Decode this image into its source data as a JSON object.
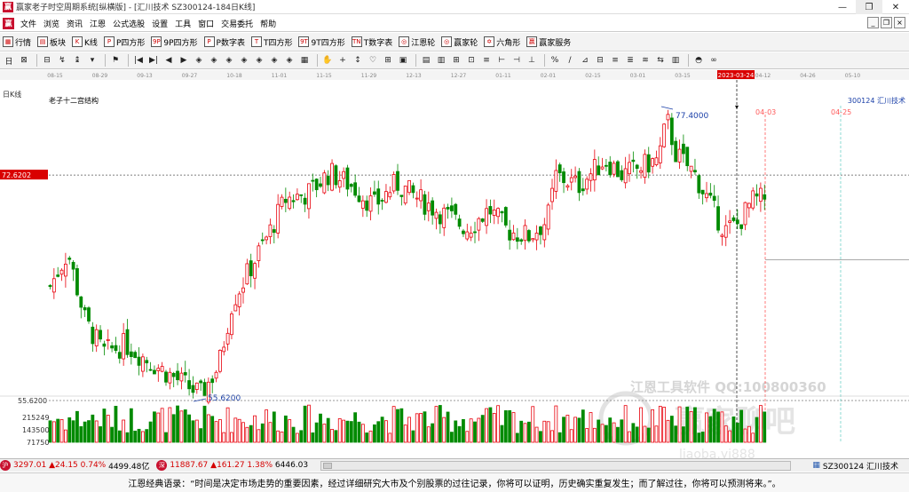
{
  "window": {
    "title": "赢家老子时空周期系统[纵横版] - [汇川技术  SZ300124-184日K线]",
    "app_icon_text": "赢",
    "buttons": [
      "—",
      "❐",
      "✕"
    ]
  },
  "menu": {
    "items": [
      "文件",
      "浏览",
      "资讯",
      "江恩",
      "公式选股",
      "设置",
      "工具",
      "窗口",
      "交易委托",
      "帮助"
    ],
    "mdi_buttons": [
      "_",
      "❐",
      "×"
    ]
  },
  "toolbar1": {
    "items": [
      {
        "glyph": "▦",
        "label": "行情"
      },
      {
        "glyph": "▤",
        "label": "板块"
      },
      {
        "glyph": "K",
        "label": "K线"
      },
      {
        "glyph": "P",
        "label": "P四方形"
      },
      {
        "glyph": "9P",
        "label": "9P四方形"
      },
      {
        "glyph": "P",
        "label": "P数字表"
      },
      {
        "glyph": "T",
        "label": "T四方形"
      },
      {
        "glyph": "9T",
        "label": "9T四方形"
      },
      {
        "glyph": "TN",
        "label": "T数字表"
      },
      {
        "glyph": "◎",
        "label": "江恩轮"
      },
      {
        "glyph": "◎",
        "label": "赢家轮"
      },
      {
        "glyph": "✡",
        "label": "六角形"
      },
      {
        "glyph": "赢",
        "label": "赢家服务"
      }
    ]
  },
  "toolbar2": {
    "icons": [
      "日",
      "⊠",
      "⊟",
      "↯",
      "↨",
      "▾",
      "⚑",
      "|◀",
      "▶|",
      "◀",
      "▶",
      "◈",
      "◈",
      "◈",
      "◈",
      "◈",
      "◈",
      "◈",
      "▦",
      "✋",
      "+",
      "↕",
      "♡",
      "⊞",
      "▣",
      "▤",
      "▥",
      "⊞",
      "⊡",
      "≡",
      "⊢",
      "⊣",
      "⊥",
      "%",
      "∕",
      "⊿",
      "⊟",
      "≡",
      "≣",
      "≋",
      "⇆",
      "▥",
      "◓",
      "∞"
    ]
  },
  "chart": {
    "period_label": "日K线",
    "indicator_name": "老子十二宫结构",
    "stock_label": "300124 汇川技术",
    "current_price_label": "72.6202",
    "high_label": "77.4000",
    "low_label": "55.6200",
    "low_axis_label": "55.6200",
    "cursor_date": "2023-03-24",
    "cycle_marks": [
      "04-03",
      "04-25"
    ],
    "volume_ticks": [
      "215249",
      "143500",
      "71750"
    ],
    "date_ticks": [
      "08-15",
      "08-29",
      "09-13",
      "09-27",
      "10-18",
      "11-01",
      "11-15",
      "11-29",
      "12-13",
      "12-27",
      "01-11",
      "02-01",
      "02-15",
      "03-01",
      "03-15",
      "04-12",
      "04-26",
      "05-10"
    ],
    "watermark_line1": "江恩工具软件  QQ:100800360",
    "watermark_line2": "赢家聊吧",
    "watermark_line3": "liaoba.yj888"
  },
  "status": {
    "sh_badge": "沪",
    "sh_index": "3297.01",
    "sh_change": "▲24.15 0.74%",
    "sh_amount": "4499.48亿",
    "sz_badge": "深",
    "sz_index": "11887.67",
    "sz_change": "▲161.27 1.38%",
    "sz_amount": "6446.03",
    "stock": "SZ300124 汇川技术"
  },
  "quote": {
    "text": "江恩经典语录：“时间是决定市场走势的重要因素，经过详细研究大市及个别股票的过往记录，你将可以证明，历史确实重复发生；而了解过往，你将可以预测将来。”。"
  },
  "colors": {
    "up": "#e8000b",
    "down": "#008a00",
    "price_tag": "#d90000",
    "cycle_line": "#ff5a5a",
    "cycle_line2": "#6fd2c8"
  }
}
